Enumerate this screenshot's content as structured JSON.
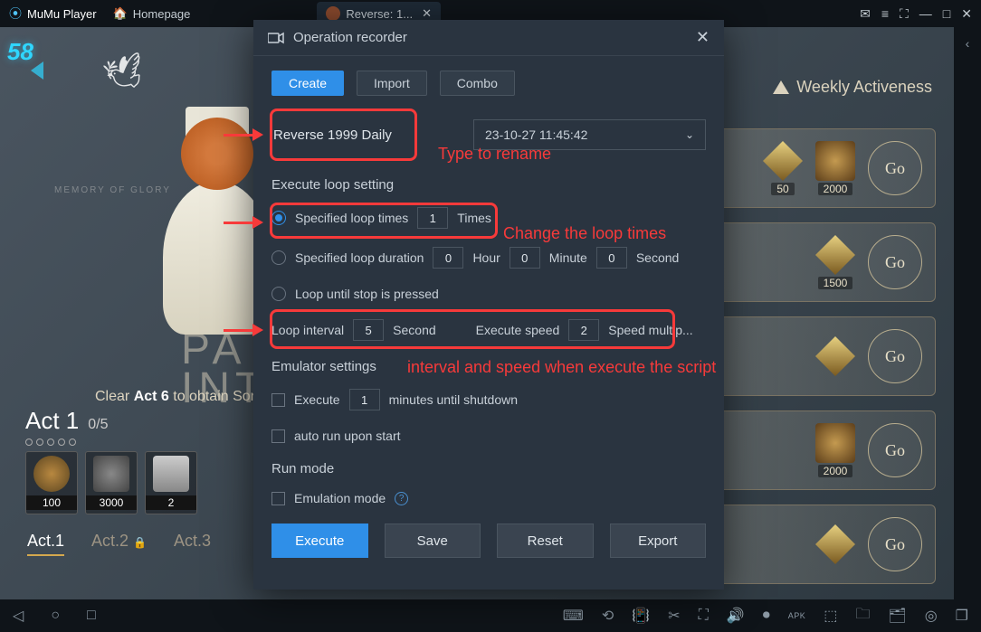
{
  "titlebar": {
    "brand": "MuMu Player",
    "homepage": "Homepage",
    "tab_title": "Reverse: 1..."
  },
  "hud": {
    "badge": "58",
    "memory": "MEMORY OF GLORY",
    "pa1": "PA",
    "pa2": "INT"
  },
  "clear_line": {
    "pre": "Clear ",
    "bold": "Act 6",
    "post": " to obtain Son"
  },
  "act": {
    "title": "Act 1",
    "count": "0/5",
    "rewards": [
      {
        "label": "100"
      },
      {
        "label": "3000"
      },
      {
        "label": "2"
      }
    ],
    "tabs": [
      "Act.1",
      "Act.2",
      "Act.3"
    ]
  },
  "weekly": "Weekly Activeness",
  "cards": [
    {
      "items": [
        {
          "v": "50"
        },
        {
          "v": "2000"
        }
      ],
      "go": "Go"
    },
    {
      "items": [
        {
          "v": "1500"
        }
      ],
      "go": "Go"
    },
    {
      "items": [],
      "go": "Go"
    },
    {
      "items": [
        {
          "v": "2000"
        }
      ],
      "go": "Go"
    },
    {
      "items": [],
      "go": "Go"
    }
  ],
  "modal": {
    "title": "Operation recorder",
    "tabs": {
      "create": "Create",
      "import": "Import",
      "combo": "Combo"
    },
    "name_value": "Reverse 1999 Daily",
    "date_value": "23-10-27 11:45:42",
    "sections": {
      "loop_title": "Execute loop setting",
      "emulator_title": "Emulator settings",
      "run_title": "Run mode"
    },
    "loop_times": {
      "label": "Specified loop times",
      "value": "1",
      "unit": "Times"
    },
    "loop_duration": {
      "label": "Specified loop duration",
      "h": "0",
      "hu": "Hour",
      "m": "0",
      "mu": "Minute",
      "s": "0",
      "su": "Second"
    },
    "loop_until": "Loop until stop is pressed",
    "interval": {
      "label": "Loop interval",
      "value": "5",
      "unit": "Second"
    },
    "speed": {
      "label": "Execute speed",
      "value": "2",
      "unit": "Speed multip..."
    },
    "shutdown": {
      "label": "Execute",
      "value": "1",
      "unit": "minutes until shutdown"
    },
    "autorun": "auto run upon start",
    "emulation": "Emulation mode",
    "actions": {
      "execute": "Execute",
      "save": "Save",
      "reset": "Reset",
      "export": "Export"
    }
  },
  "annotations": {
    "rename": "Type to rename",
    "loop": "Change the loop times",
    "interval": "interval and speed when execute the script"
  },
  "bottombar": {
    "apk": "APK"
  }
}
